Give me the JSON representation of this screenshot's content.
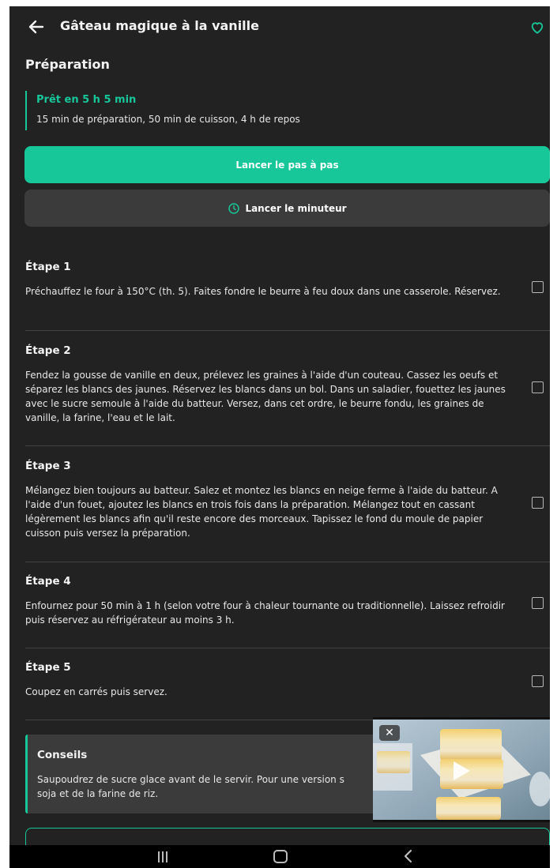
{
  "header": {
    "title": "Gâteau magique à la vanille",
    "back_icon": "arrow-left-icon",
    "favorite_icon": "heart-icon"
  },
  "preparation": {
    "section_title": "Préparation",
    "ready_title": "Prêt en 5 h 5 min",
    "ready_detail": "15 min de préparation, 50 min de cuisson, 4 h de repos"
  },
  "actions": {
    "step_by_step_label": "Lancer le pas à pas",
    "timer_label": "Lancer le minuteur",
    "timer_icon": "clock-icon"
  },
  "steps": [
    {
      "title": "Étape 1",
      "text": "Préchauffez le four à 150°C (th. 5). Faites fondre le beurre à feu doux dans une casserole. Réservez."
    },
    {
      "title": "Étape 2",
      "text": "Fendez la gousse de vanille en deux, prélevez les graines à l'aide d'un couteau. Cassez les oeufs et séparez les blancs des jaunes. Réservez les blancs dans un bol. Dans un saladier, fouettez les jaunes avec le sucre semoule à l'aide du batteur. Versez, dans cet ordre, le beurre fondu, les graines de vanille, la farine, l'eau et le lait."
    },
    {
      "title": "Étape 3",
      "text": "Mélangez bien toujours au batteur. Salez et montez les blancs en neige ferme à l'aide du batteur. A l'aide d'un fouet, ajoutez les blancs en trois fois dans la préparation. Mélangez tout en cassant légèrement les blancs afin qu'il reste encore des morceaux. Tapissez le fond du moule de papier cuisson puis versez la préparation."
    },
    {
      "title": "Étape 4",
      "text": "Enfournez pour 50 min à 1 h (selon votre four à chaleur tournante ou traditionnelle). Laissez refroidir puis réservez au réfrigérateur au moins 3 h."
    },
    {
      "title": "Étape 5",
      "text": "Coupez en carrés puis servez."
    }
  ],
  "tips": {
    "title": "Conseils",
    "text": "Saupoudrez de sucre glace avant de le servir. Pour une version s... soja et de la farine de riz.",
    "text_line1": "Saupoudrez de sucre glace avant de le servir. Pour une version s",
    "text_line2": "soja et de la farine de riz."
  },
  "video": {
    "close_label": "✕",
    "play_icon": "play-icon"
  },
  "colors": {
    "accent": "#17c79a",
    "background": "#222222",
    "secondary_button": "#3b3b3b"
  }
}
